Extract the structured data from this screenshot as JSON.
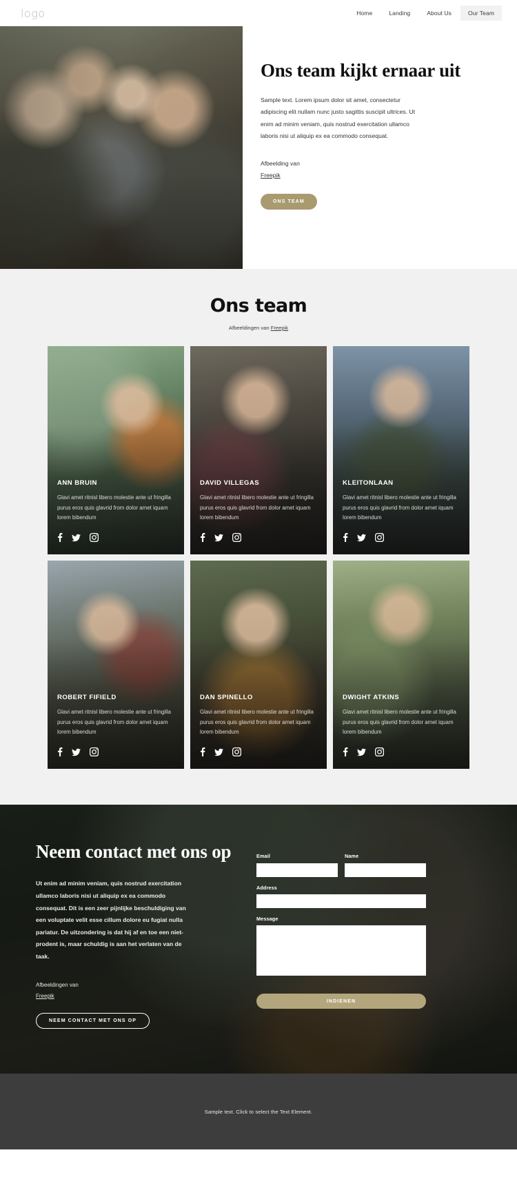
{
  "header": {
    "logo": "logo",
    "nav": [
      {
        "label": "Home",
        "active": false
      },
      {
        "label": "Landing",
        "active": false
      },
      {
        "label": "About Us",
        "active": false
      },
      {
        "label": "Our Team",
        "active": true
      }
    ]
  },
  "hero": {
    "image_alt": "group-of-friends-hiking-looking-at-tablet",
    "title": "Ons team kijkt ernaar uit",
    "body": "Sample text. Lorem ipsum dolor sit amet, consectetur adipiscing elit nullam nunc justo sagittis suscipit ultrices. Ut enim ad minim veniam, quis nostrud exercitation ullamco laboris nisi ut aliquip ex ea commodo consequat.",
    "credit_label": "Afbeelding van",
    "credit_link": "Freepik",
    "cta": "ONS TEAM"
  },
  "team": {
    "title": "Ons team",
    "subtitle_prefix": "Afbeeldingen van ",
    "subtitle_link": "Freepik",
    "card_description": "Glavi amet ritnisl libero molestie ante ut fringilla purus eros quis glavrid from dolor amet iquam lorem bibendum",
    "socials": [
      "facebook-icon",
      "twitter-icon",
      "instagram-icon"
    ],
    "members": [
      {
        "name": "ANN BRUIN",
        "photo": "p1"
      },
      {
        "name": "DAVID VILLEGAS",
        "photo": "p2"
      },
      {
        "name": "KLEITONLAAN",
        "photo": "p3"
      },
      {
        "name": "ROBERT FIFIELD",
        "photo": "p4"
      },
      {
        "name": "DAN SPINELLO",
        "photo": "p5"
      },
      {
        "name": "DWIGHT ATKINS",
        "photo": "p6"
      }
    ]
  },
  "contact": {
    "title": "Neem contact met ons op",
    "body": "Ut enim ad minim veniam, quis nostrud exercitation ullamco laboris nisi ut aliquip ex ea commodo consequat. Dit is een zeer pijnlijke beschuldiging van een voluptate velit esse cillum dolore eu fugiat nulla pariatur. De uitzondering is dat hij af en toe een niet-prodent is, maar schuldig is aan het verlaten van de taak.",
    "credit_label": "Afbeeldingen van",
    "credit_link": "Freepik",
    "cta": "NEEM CONTACT MET ONS OP",
    "form": {
      "email_label": "Email",
      "email_value": "",
      "email_placeholder": "",
      "name_label": "Name",
      "name_value": "",
      "name_placeholder": "",
      "address_label": "Address",
      "address_value": "",
      "address_placeholder": "",
      "message_label": "Message",
      "message_value": "",
      "message_placeholder": "",
      "submit": "INDIENEN"
    }
  },
  "footer": {
    "text": "Sample text. Click to select the Text Element."
  },
  "colors": {
    "gold": "#a99a6f",
    "gold_submit": "#b3a67c",
    "section_bg": "#f1f1f1",
    "footer_bg": "#3d3d3d",
    "nav_active_bg": "#f2f2f2"
  }
}
